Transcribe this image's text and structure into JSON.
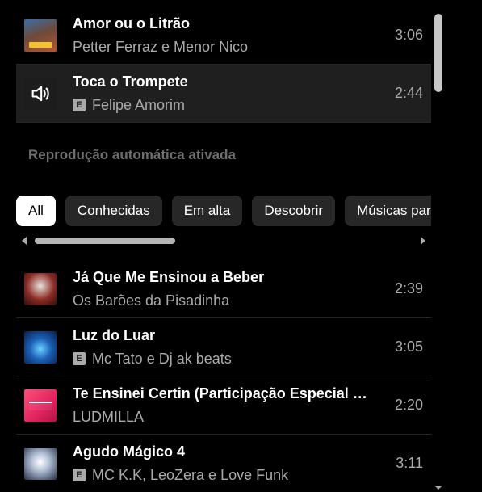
{
  "queue": [
    {
      "title": "Amor ou o Litrão",
      "artist": "Petter Ferraz e Menor Nico",
      "duration": "3:06",
      "explicit": false,
      "active": false,
      "thumb": "album-art"
    },
    {
      "title": "Toca o Trompete",
      "artist": "Felipe Amorim",
      "duration": "2:44",
      "explicit": true,
      "active": true,
      "thumb": "now-playing-speaker-icon"
    }
  ],
  "autoplay_label": "Reprodução automática ativada",
  "chips": [
    {
      "label": "All",
      "selected": true
    },
    {
      "label": "Conhecidas",
      "selected": false
    },
    {
      "label": "Em alta",
      "selected": false
    },
    {
      "label": "Descobrir",
      "selected": false
    },
    {
      "label": "Músicas para você",
      "selected": false
    }
  ],
  "upnext": [
    {
      "title": "Já Que Me Ensinou a Beber",
      "artist": "Os Barões da Pisadinha",
      "duration": "2:39",
      "explicit": false
    },
    {
      "title": "Luz do Luar",
      "artist": "Mc Tato e Dj ak beats",
      "duration": "3:05",
      "explicit": true
    },
    {
      "title": "Te Ensinei Certin (Participação Especial de Ana Castela)",
      "artist": "LUDMILLA",
      "duration": "2:20",
      "explicit": false
    },
    {
      "title": "Agudo Mágico 4",
      "artist": "MC K.K, LeoZera e Love Funk",
      "duration": "3:11",
      "explicit": true
    }
  ],
  "explicit_badge": "E"
}
